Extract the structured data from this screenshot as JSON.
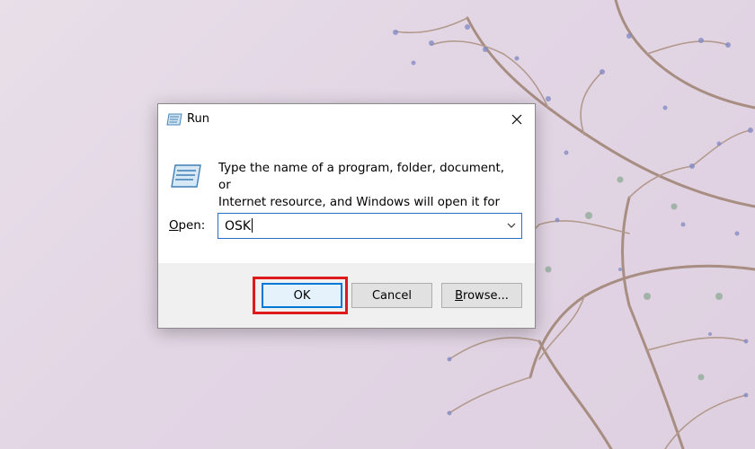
{
  "dialog": {
    "title": "Run",
    "description_line1": "Type the name of a program, folder, document, or",
    "description_line2": "Internet resource, and Windows will open it for you.",
    "open_label_underline": "O",
    "open_label_rest": "pen:",
    "open_value": "OSK",
    "buttons": {
      "ok": "OK",
      "cancel": "Cancel",
      "browse_underline": "B",
      "browse_rest": "rowse..."
    }
  },
  "icons": {
    "title": "run-icon",
    "large": "run-icon",
    "close": "close-icon",
    "dropdown": "chevron-down-icon"
  },
  "colors": {
    "highlight": "#e01a1a",
    "focus_border": "#0078d7",
    "wallpaper": "#e4d8e6"
  }
}
